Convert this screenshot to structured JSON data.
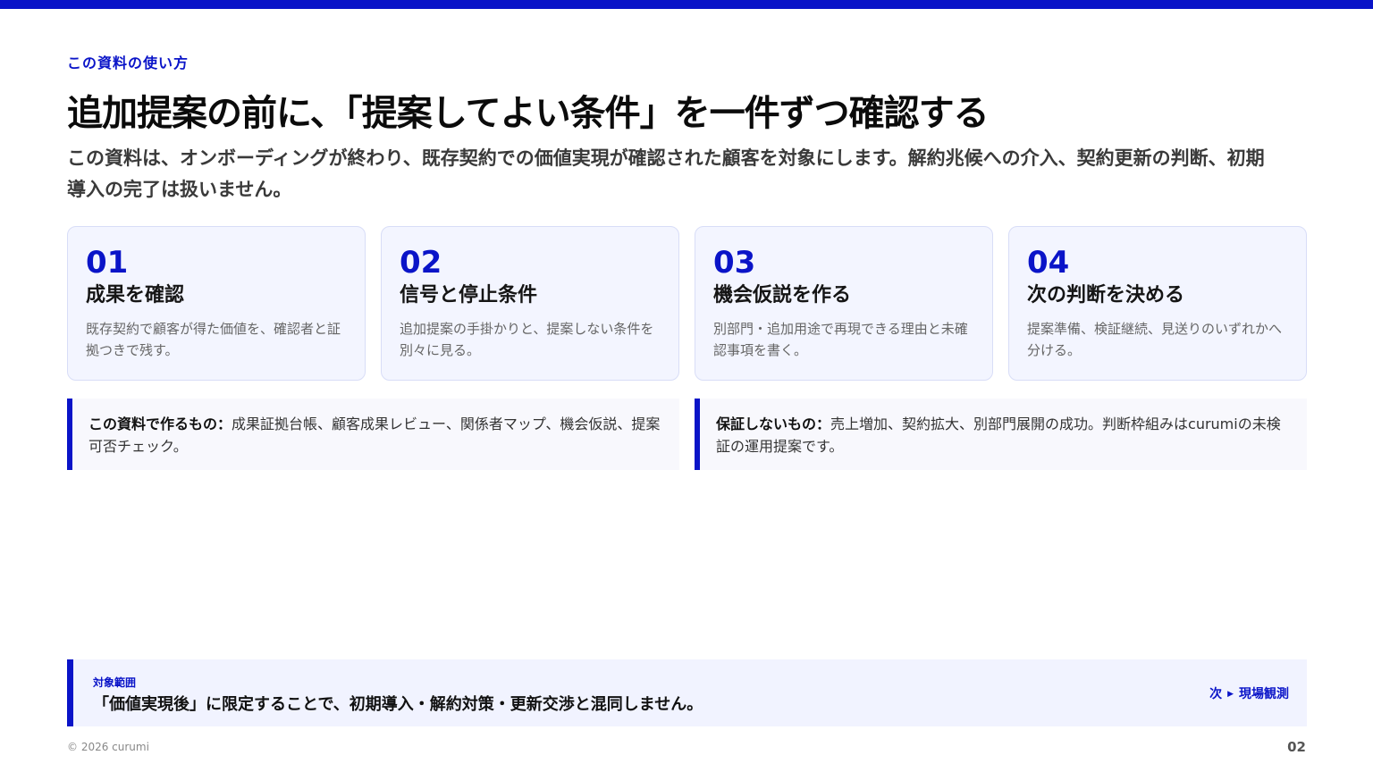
{
  "header": {
    "eyebrow": "この資料の使い方",
    "title": "追加提案の前に、「提案してよい条件」を一件ずつ確認する",
    "lead": "この資料は、オンボーディングが終わり、既存契約での価値実現が確認された顧客を対象にします。解約兆候への介入、契約更新の判断、初期導入の完了は扱いません。"
  },
  "cards": [
    {
      "num": "01",
      "title": "成果を確認",
      "desc": "既存契約で顧客が得た価値を、確認者と証拠つきで残す。"
    },
    {
      "num": "02",
      "title": "信号と停止条件",
      "desc": "追加提案の手掛かりと、提案しない条件を別々に見る。"
    },
    {
      "num": "03",
      "title": "機会仮説を作る",
      "desc": "別部門・追加用途で再現できる理由と未確認事項を書く。"
    },
    {
      "num": "04",
      "title": "次の判断を決める",
      "desc": "提案準備、検証継続、見送りのいずれかへ分ける。"
    }
  ],
  "notes": [
    {
      "label": "この資料で作るもの：",
      "text": "成果証拠台帳、顧客成果レビュー、関係者マップ、機会仮説、提案可否チェック。"
    },
    {
      "label": "保証しないもの：",
      "text": "売上増加、契約拡大、別部門展開の成功。判断枠組みはcurumiの未検証の運用提案です。"
    }
  ],
  "scope": {
    "label": "対象範囲",
    "text": "「価値実現後」に限定することで、初期導入・解約対策・更新交渉と混同しません。",
    "next_prefix": "次",
    "next_label": "現場観測"
  },
  "footer": {
    "copyright": "© 2026 curumi",
    "page": "02"
  },
  "colors": {
    "accent": "#0a14c8",
    "card_bg": "#f3f5ff",
    "note_bg": "#f8f8fd"
  }
}
